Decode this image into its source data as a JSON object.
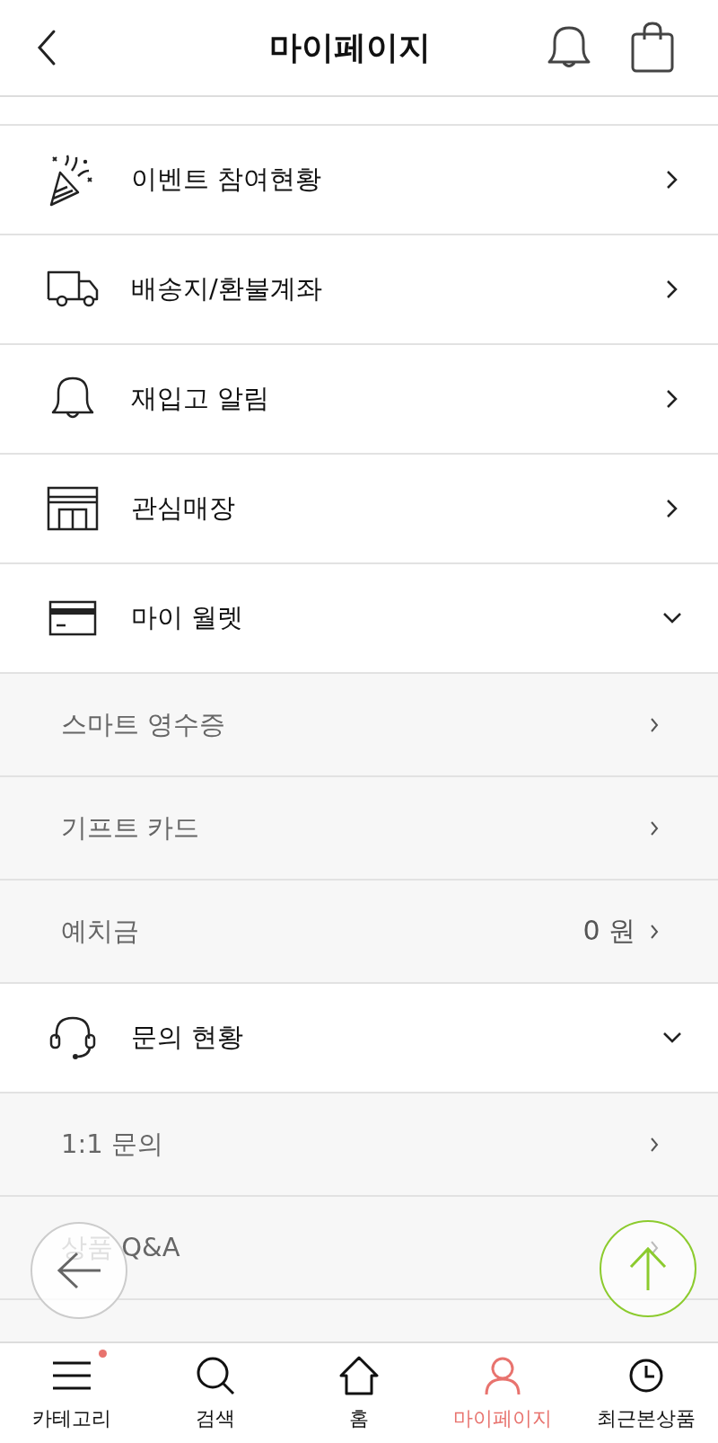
{
  "header": {
    "title": "마이페이지"
  },
  "sections": [
    {
      "label": "이벤트 참여현황"
    },
    {
      "label": "배송지/환불계좌"
    },
    {
      "label": "재입고 알림"
    },
    {
      "label": "관심매장"
    },
    {
      "label": "마이 월렛",
      "expanded": true,
      "children": [
        {
          "label": "스마트 영수증"
        },
        {
          "label": "기프트 카드"
        },
        {
          "label": "예치금",
          "value": "0 원"
        }
      ]
    },
    {
      "label": "문의 현황",
      "expanded": true,
      "children": [
        {
          "label": "1:1 문의"
        },
        {
          "label": "상품 Q&A"
        }
      ]
    }
  ],
  "bottom_nav": [
    {
      "label": "카테고리",
      "selected": false,
      "notification_dot": true
    },
    {
      "label": "검색",
      "selected": false,
      "notification_dot": false
    },
    {
      "label": "홈",
      "selected": false,
      "notification_dot": false
    },
    {
      "label": "마이페이지",
      "selected": true,
      "notification_dot": false
    },
    {
      "label": "최근본상품",
      "selected": false,
      "notification_dot": false
    }
  ]
}
